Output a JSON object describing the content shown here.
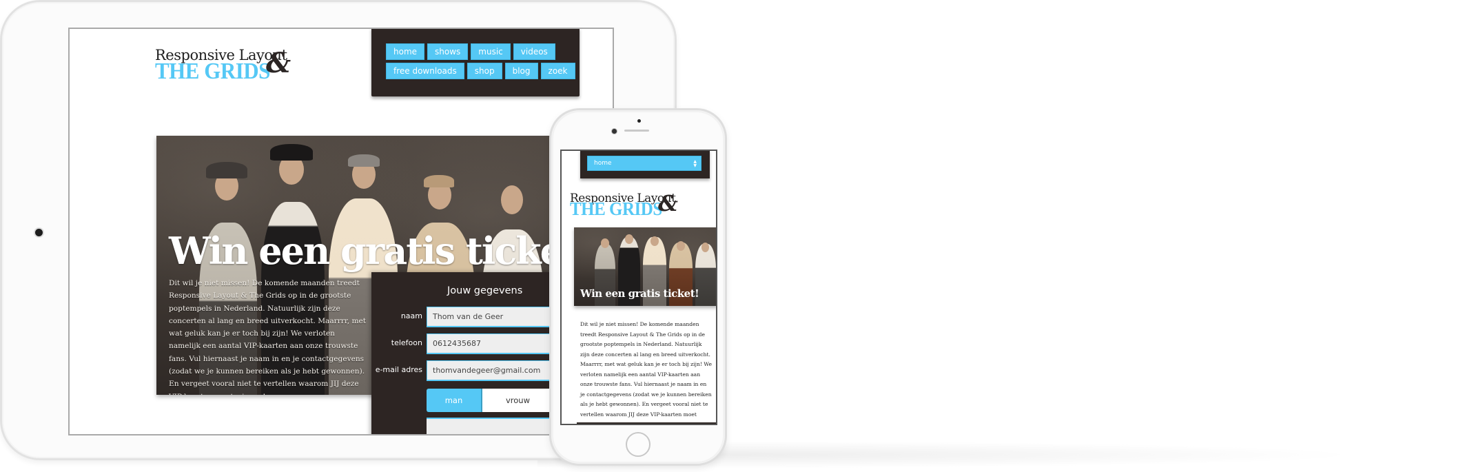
{
  "brand": {
    "logo_line1": "Responsive Layout",
    "logo_line2": "THE GRIDS",
    "logo_ampersand": "&",
    "accent_color": "#55c8f5",
    "dark_color": "#2d2523"
  },
  "tablet": {
    "nav": {
      "row1": [
        "home",
        "shows",
        "music",
        "videos"
      ],
      "row2": [
        "free downloads",
        "shop",
        "blog",
        "zoek"
      ]
    },
    "hero": {
      "title": "Win een gratis ticket!",
      "body": "Dit wil je niet missen! De komende maanden treedt Responsive Layout & The Grids op in de grootste poptempels in Nederland. Natuurlijk zijn deze concerten al lang en breed uitverkocht. Maarrrr, met wat geluk kan je er toch bij zijn! We verloten namelijk een aantal VIP-kaarten aan onze trouwste fans. Vul hiernaast je naam in en je contactgegevens (zodat we je kunnen bereiken als je hebt gewonnen). En vergeet vooral niet te vertellen waarom JIJ deze VIP-kaarten moet winnen!"
    },
    "form": {
      "title": "Jouw gegevens",
      "fields": [
        {
          "label": "naam",
          "value": "Thom van de Geer"
        },
        {
          "label": "telefoon",
          "value": "0612435687"
        },
        {
          "label": "e-mail adres",
          "value": "thomvandegeer@gmail.com"
        }
      ],
      "gender_options": [
        "man",
        "vrouw"
      ],
      "gender_selected": "man"
    }
  },
  "phone": {
    "nav_select_value": "home",
    "hero_title": "Win een gratis ticket!",
    "body": "Dit wil je niet missen! De komende maanden treedt Responsive Layout & The Grids op in de grootste poptempels in Nederland. Natuurlijk zijn deze concerten al lang en breed uitverkocht. Maarrrr, met wat geluk kan je er toch bij zijn! We verloten namelijk een aantal VIP-kaarten aan onze trouwste fans. Vul hiernaast je naam in en je contactgegevens (zodat we je kunnen bereiken als je hebt gewonnen). En vergeet vooral niet te vertellen waarom JIJ deze VIP-kaarten moet"
  }
}
